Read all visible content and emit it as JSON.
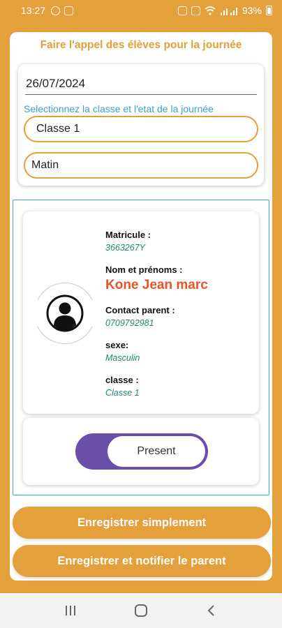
{
  "status_bar": {
    "time": "13:27",
    "battery": "93%"
  },
  "page": {
    "title": "Faire l'appel des élèves pour la journée"
  },
  "form": {
    "date": "26/07/2024",
    "hint": "Selectionnez la classe et l'etat de la journée",
    "class_value": "Classe 1",
    "period_value": "Matin"
  },
  "student": {
    "matricule_label": "Matricule :",
    "matricule": "3663267Y",
    "name_label": "Nom et prénoms :",
    "name": "Kone Jean marc",
    "contact_label": "Contact parent :",
    "contact": "0709792981",
    "sexe_label": "sexe:",
    "sexe": "Masculin",
    "classe_label": "classe :",
    "classe": "Classe 1",
    "avatar_icon": "user-avatar-icon"
  },
  "attendance": {
    "state": "Present"
  },
  "actions": {
    "save_label": "Enregistrer simplement",
    "notify_label": "Enregistrer et notifier le parent"
  },
  "colors": {
    "accent": "#e4a03a",
    "name": "#e8542a",
    "value": "#1f8a75",
    "hint": "#3a9fd6",
    "toggle": "#6a4ea8"
  }
}
